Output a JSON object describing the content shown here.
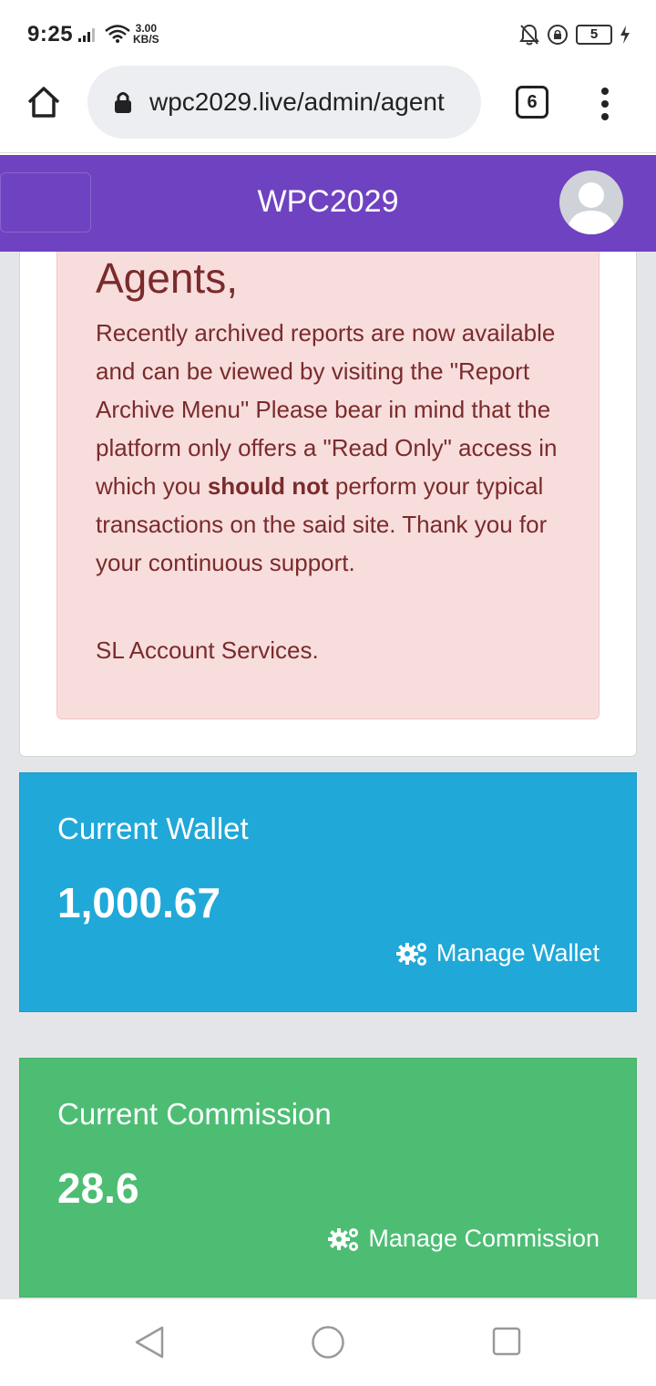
{
  "status_bar": {
    "time": "9:25",
    "net_speed_value": "3.00",
    "net_speed_unit": "KB/S",
    "battery_level": "5",
    "icons": [
      "signal-icon",
      "wifi-icon",
      "bell-off-icon",
      "rotation-lock-icon",
      "battery-icon",
      "charging-icon"
    ]
  },
  "browser": {
    "url": "wpc2029.live/admin/agent",
    "tab_count": "6",
    "icons": [
      "home-icon",
      "lock-icon",
      "tabs-icon",
      "more-vert-icon"
    ]
  },
  "app": {
    "brand": "WPC2029",
    "brand_color": "#6f42c1"
  },
  "notice": {
    "heading": "Agents,",
    "body_part1": "Recently archived reports are now available and can be viewed by visiting the \"Report Archive Menu\" Please bear in mind that the platform only offers a \"Read Only\" access in which you ",
    "body_bold": "should not",
    "body_part2": " perform your typical transactions on the said site. Thank you for your continuous support.",
    "signature": "SL Account Services."
  },
  "wallet": {
    "label": "Current Wallet",
    "value": "1,000.67",
    "link": "Manage Wallet",
    "color": "#20a8d8"
  },
  "commission": {
    "label": "Current Commission",
    "value": "28.6",
    "link": "Manage Commission",
    "color": "#4dbd74"
  },
  "system_nav": {
    "icons": [
      "back-icon",
      "home-circle-icon",
      "recents-icon"
    ]
  }
}
